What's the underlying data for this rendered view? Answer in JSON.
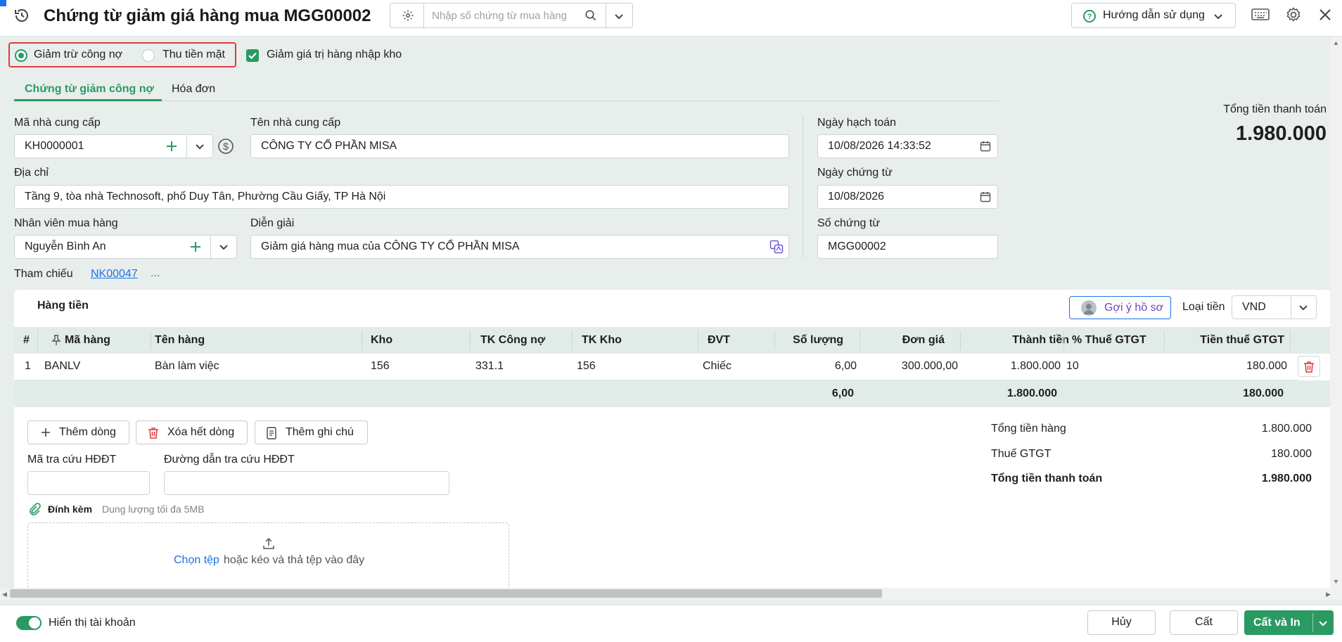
{
  "header": {
    "title": "Chứng từ giảm giá hàng mua MGG00002",
    "search_placeholder": "Nhập số chứng từ mua hàng",
    "help_label": "Hướng dẫn sử dụng"
  },
  "options": {
    "radio_debt": "Giảm trừ công nợ",
    "radio_cash": "Thu tiền mặt",
    "selected": "Giảm trừ công nợ",
    "checkbox_label": "Giảm giá trị hàng nhập kho",
    "checkbox_checked": true
  },
  "tabs": [
    {
      "label": "Chứng từ giảm công nợ",
      "active": true
    },
    {
      "label": "Hóa đơn",
      "active": false
    }
  ],
  "form": {
    "supplier_code_label": "Mã nhà cung cấp",
    "supplier_code": "KH0000001",
    "supplier_name_label": "Tên nhà cung cấp",
    "supplier_name": "CÔNG TY CỔ PHẦN MISA",
    "address_label": "Địa chỉ",
    "address": "Tầng 9, tòa nhà Technosoft, phố Duy Tân, Phường Cầu Giấy, TP Hà Nội",
    "employee_label": "Nhân viên mua hàng",
    "employee": "Nguyễn Bình An",
    "description_label": "Diễn giải",
    "description": "Giảm giá hàng mua của CÔNG TY CỔ PHẦN MISA",
    "posting_date_label": "Ngày hạch toán",
    "posting_date": "10/08/2026 14:33:52",
    "voucher_date_label": "Ngày chứng từ",
    "voucher_date": "10/08/2026",
    "voucher_no_label": "Số chứng từ",
    "voucher_no": "MGG00002",
    "reference_label": "Tham chiếu",
    "reference_link": "NK00047",
    "reference_more": "..."
  },
  "summary_top": {
    "label": "Tổng tiền thanh toán",
    "value": "1.980.000"
  },
  "grid": {
    "section_title": "Hàng tiền",
    "suggest_label": "Gợi ý hồ sơ",
    "currency_label": "Loại tiền",
    "currency": "VND",
    "columns": [
      "#",
      "Mã hàng",
      "Tên hàng",
      "Kho",
      "TK Công nợ",
      "TK Kho",
      "ĐVT",
      "Số lượng",
      "Đơn giá",
      "Thành tiền",
      "% Thuế GTGT",
      "Tiền thuế GTGT"
    ],
    "rows": [
      {
        "no": "1",
        "code": "BANLV",
        "name": "Bàn làm việc",
        "warehouse": "156",
        "debt_acc": "331.1",
        "stock_acc": "156",
        "unit": "Chiếc",
        "qty": "6,00",
        "price": "300.000,00",
        "amount": "1.800.000",
        "vat_rate": "10",
        "vat": "180.000"
      }
    ],
    "totals": {
      "qty": "6,00",
      "amount": "1.800.000",
      "vat": "180.000"
    }
  },
  "actions": {
    "add_row": "Thêm dòng",
    "delete_all": "Xóa hết dòng",
    "add_note": "Thêm ghi chú"
  },
  "einvoice": {
    "lookup_code_label": "Mã tra cứu HĐĐT",
    "lookup_code": "",
    "lookup_url_label": "Đường dẫn tra cứu HĐĐT",
    "lookup_url": ""
  },
  "attach": {
    "label": "Đính kèm",
    "limit": "Dung lượng tối đa 5MB",
    "choose": "Chọn tệp",
    "drop_text": "hoặc kéo và thả tệp vào đây"
  },
  "totals": {
    "goods_label": "Tổng tiền hàng",
    "goods": "1.800.000",
    "vat_label": "Thuế GTGT",
    "vat": "180.000",
    "total_label": "Tổng tiền thanh toán",
    "total": "1.980.000"
  },
  "footer": {
    "toggle_label": "Hiển thị tài khoản",
    "toggle_on": true,
    "cancel": "Hủy",
    "save": "Cất",
    "save_print": "Cất và In"
  },
  "colors": {
    "accent": "#2a9a62",
    "highlight": "#e0393e",
    "link": "#1a73e8"
  }
}
